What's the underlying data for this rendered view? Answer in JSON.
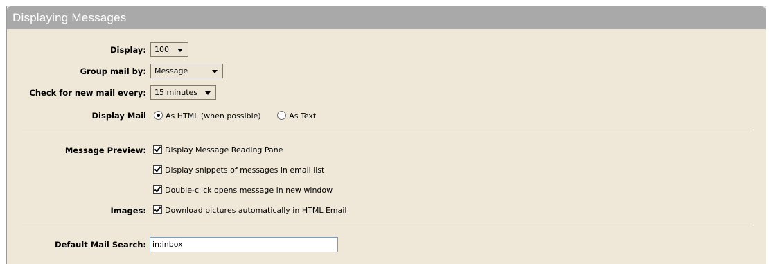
{
  "header": {
    "title": "Displaying Messages"
  },
  "display": {
    "label": "Display:",
    "value": "100"
  },
  "group_mail": {
    "label": "Group mail by:",
    "value": "Message"
  },
  "check_mail": {
    "label": "Check for new mail every:",
    "value": "15 minutes"
  },
  "display_mail": {
    "label": "Display Mail",
    "options": [
      {
        "label": "As HTML (when possible)",
        "selected": true
      },
      {
        "label": "As Text",
        "selected": false
      }
    ]
  },
  "message_preview": {
    "label": "Message Preview:",
    "options": [
      {
        "label": "Display Message Reading Pane",
        "checked": true
      },
      {
        "label": "Display snippets of messages in email list",
        "checked": true
      },
      {
        "label": "Double-click opens message in new window",
        "checked": true
      }
    ]
  },
  "images": {
    "label": "Images:",
    "option": {
      "label": "Download pictures automatically in HTML Email",
      "checked": true
    }
  },
  "default_search": {
    "label": "Default Mail Search:",
    "value": "in:inbox"
  },
  "colors": {
    "panel_bg": "#efe8d9",
    "header_bg": "#a9a9a9",
    "header_text": "#ffffff"
  }
}
